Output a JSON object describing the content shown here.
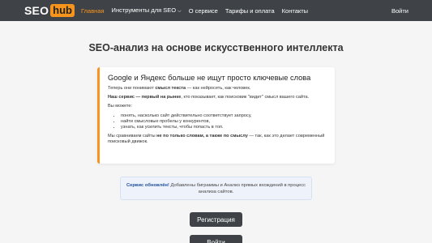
{
  "navbar": {
    "logo_seo": "SEO",
    "logo_hub": "hub",
    "items": [
      {
        "label": "Главная"
      },
      {
        "label": "Инструменты для SEO"
      },
      {
        "label": "О сервисе"
      },
      {
        "label": "Тарифы и оплата"
      },
      {
        "label": "Контакты"
      }
    ],
    "login": "Войти"
  },
  "page_title": "SEO-анализ на основе искусственного интеллекта",
  "card": {
    "title": "Google и Яндекс больше не ищут просто ключевые слова",
    "p1": {
      "a": "Теперь они понимают ",
      "b": "смысл текста",
      "c": " — как нейросеть, как человек."
    },
    "p2": {
      "b": "Наш сервис — первый на рынке",
      "c": ", кто показывает, как поисковик \"видит\" смысл вашего сайта."
    },
    "p3": "Вы можете:",
    "list": [
      "понять, насколько сайт действительно соответствует запросу,",
      "найти смысловые пробелы у конкурентов,",
      "узнать, как усилить тексты, чтобы попасть в топ."
    ],
    "p4": {
      "a": "Мы сравниваем сайты ",
      "b": "не по только словам, а также по смыслу",
      "c": " — так, как это делает современный поисковый движок."
    }
  },
  "notice": {
    "bold": "Сервис обновлён!",
    "text": " Добавлены биграммы и Анализ прямых вхождений в процесс анализа сайтов."
  },
  "buttons": {
    "register": "Регистрация",
    "login": "Войти"
  },
  "colors": {
    "navbar": "#3f4347",
    "accent": "#f7941d",
    "notice_bg": "#eef3fb"
  }
}
